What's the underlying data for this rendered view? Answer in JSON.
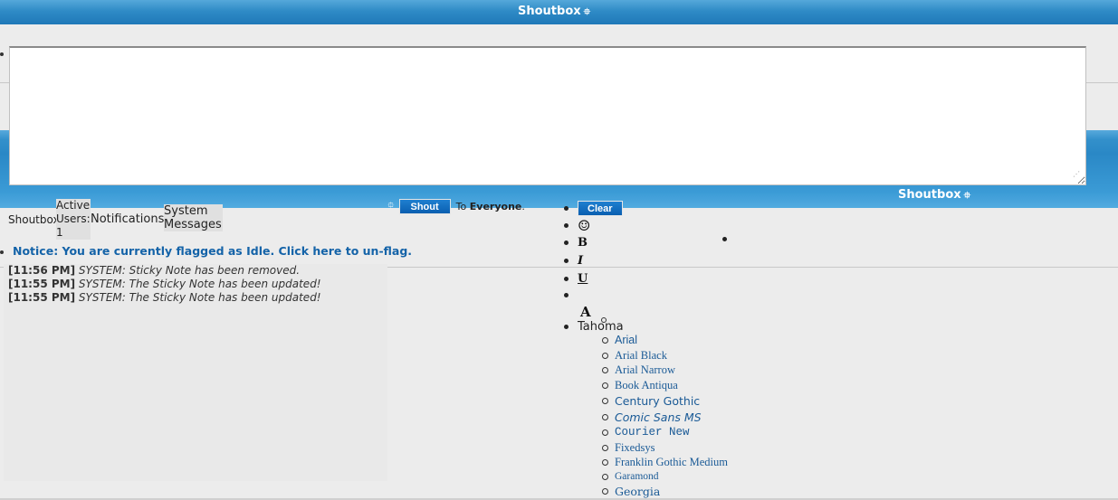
{
  "header": {
    "title": "Shoutbox",
    "glyph": "⯐"
  },
  "editor": {
    "placeholder": ""
  },
  "shout_bar": {
    "icon": "⯐",
    "shout_label": "Shout",
    "to_prefix": "To",
    "recipient": "Everyone",
    "suffix": "."
  },
  "tabs": {
    "shoutbox": "Shoutbox",
    "active_users": "Active Users: 1",
    "notifications": "Notifications",
    "system_messages": "System Messages"
  },
  "notice": "Notice: You are currently flagged as Idle. Click here to un-flag.",
  "messages": [
    {
      "time": "[11:56 PM]",
      "text": "SYSTEM: Sticky Note has been removed."
    },
    {
      "time": "[11:55 PM]",
      "text": "SYSTEM: The Sticky Note has been updated!"
    },
    {
      "time": "[11:55 PM]",
      "text": "SYSTEM: The Sticky Note has been updated!"
    }
  ],
  "toolbar": {
    "clear_label": "Clear",
    "smiley": "☺",
    "bold": "B",
    "italic": "I",
    "underline": "U",
    "font_color": "A",
    "font_name": "Tahoma"
  },
  "right_panel": {
    "title": "Shoutbox",
    "glyph": "⯐"
  },
  "fonts": [
    "Arial",
    "Arial Black",
    "Arial Narrow",
    "Book Antiqua",
    "Century Gothic",
    "Comic Sans MS",
    "Courier New",
    "Fixedsys",
    "Franklin Gothic Medium",
    "Garamond",
    "Georgia"
  ],
  "colors": {
    "accent_blue": "#2f8bc6",
    "button_blue": "#0a5fb0",
    "link_blue": "#1463a8"
  }
}
